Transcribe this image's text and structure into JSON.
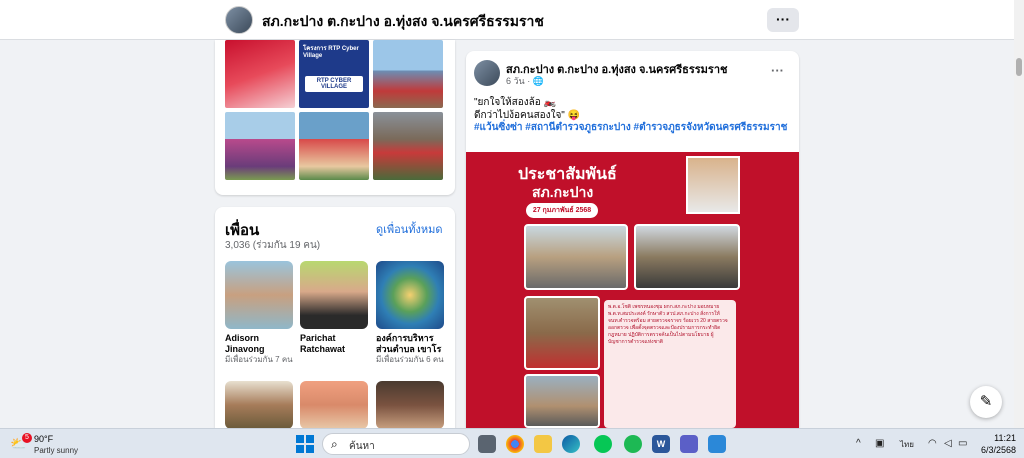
{
  "header": {
    "title": "สภ.กะปาง ต.กะปาง อ.ทุ่งสง จ.นครศรีธรรมราช",
    "more_label": "···"
  },
  "photos": {
    "items": [
      {
        "label": "",
        "color": "#c8102e"
      },
      {
        "label": "RTP CYBER VILLAGE",
        "color": "#1e3a8a"
      },
      {
        "label": "",
        "color": "#6b8fb5"
      },
      {
        "label": "",
        "color": "#4a7bbf"
      },
      {
        "label": "",
        "color": "#6aa0c9"
      },
      {
        "label": "",
        "color": "#8a9199"
      }
    ],
    "banner_title": "โครงการ RTP Cyber Village"
  },
  "friends": {
    "heading": "เพื่อน",
    "see_all": "ดูเพื่อนทั้งหมด",
    "count": "3,036 (ร่วมกัน 19 คน)",
    "list": [
      {
        "name": "Adisorn Jinavong",
        "mutual": "มีเพื่อนร่วมกัน 7 คน",
        "color": "#8fb7c9"
      },
      {
        "name": "Parichat Ratchawat",
        "mutual": "",
        "color": "#d8a98a"
      },
      {
        "name": "องค์การบริหารส่วนตำบล เขาโร",
        "mutual": "มีเพื่อนร่วมกัน 6 คน",
        "color": "#2f7fb5"
      },
      {
        "name": "",
        "mutual": "",
        "color": "#a67c5a"
      },
      {
        "name": "",
        "mutual": "",
        "color": "#d98a6a"
      },
      {
        "name": "",
        "mutual": "",
        "color": "#7a5240"
      }
    ]
  },
  "post": {
    "author": "สภ.กะปาง ต.กะปาง อ.ทุ่งสง จ.นครศรีธรรมราช",
    "time": "6 วัน · 🌐",
    "more_label": "···",
    "line1": "\"ยกใจให้สองล้อ 🏍️",
    "line2": "ดีกว่าไปง้อคนสองใจ\" 😝",
    "hashtags": "#แว้นซิ่งซ่า #สถานีตำรวจภูธรกะปาง #ตำรวจภูธรจังหวัดนครศรีธรรมราช",
    "banner": {
      "title": "ประชาสัมพันธ์",
      "subtitle": "สภ.กะปาง",
      "date": "27 กุมภาพันธ์ 2568",
      "body": "พ.ต.อ.โชติ เพชรหนองชุม ผกก.สภ.กะปาง มอบหมาย พ.ต.ท.สมประสงค์ รักษาตัว สวป.สภ.กะปาง สั่งการให้ จนท.ตำรวจพร้อม สายตรวจจราจร ร้อยเวร 20 สายตรวจออกตรวจ เพื่อตั้งจุดตรวจและป้องปรามการกระทำผิดกฎหมาย ปฏิบัติการตรวจค้นเป็นไปตามนโยบาย ผู้บัญชาการตำรวจแห่งชาติ"
    }
  },
  "taskbar": {
    "temperature": "90°F",
    "condition": "Partly sunny",
    "weather_badge": "5",
    "search_placeholder": "ค้นหา",
    "language": "ไทย",
    "time": "11:21",
    "date": "6/3/2568"
  }
}
